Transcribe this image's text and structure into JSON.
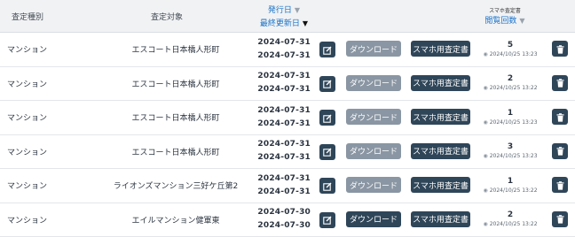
{
  "header": {
    "type": "査定種別",
    "target": "査定対象",
    "issue_date": "発行日",
    "updated_date": "最終更新日",
    "views_sub": "スマホ査定書",
    "views": "閲覧回数",
    "sort_neutral_icon": "▼",
    "sort_active_icon": "▼"
  },
  "colors": {
    "dark_button": "#2f4659",
    "disabled_button": "#8a96a3",
    "link_blue": "#1a73c9"
  },
  "rows": [
    {
      "type": "マンション",
      "target": "エスコート日本橋人形町",
      "issued": "2024-07-31",
      "updated": "2024-07-31",
      "download": "ダウンロード",
      "download_enabled": false,
      "smartphone": "スマホ用査定書",
      "views": "5",
      "viewed_at": "2024/10/25 13:23"
    },
    {
      "type": "マンション",
      "target": "エスコート日本橋人形町",
      "issued": "2024-07-31",
      "updated": "2024-07-31",
      "download": "ダウンロード",
      "download_enabled": false,
      "smartphone": "スマホ用査定書",
      "views": "2",
      "viewed_at": "2024/10/25 13:22"
    },
    {
      "type": "マンション",
      "target": "エスコート日本橋人形町",
      "issued": "2024-07-31",
      "updated": "2024-07-31",
      "download": "ダウンロード",
      "download_enabled": false,
      "smartphone": "スマホ用査定書",
      "views": "1",
      "viewed_at": "2024/10/25 13:23"
    },
    {
      "type": "マンション",
      "target": "エスコート日本橋人形町",
      "issued": "2024-07-31",
      "updated": "2024-07-31",
      "download": "ダウンロード",
      "download_enabled": false,
      "smartphone": "スマホ用査定書",
      "views": "3",
      "viewed_at": "2024/10/25 13:23"
    },
    {
      "type": "マンション",
      "target": "ライオンズマンション三好ケ丘第2",
      "issued": "2024-07-31",
      "updated": "2024-07-31",
      "download": "ダウンロード",
      "download_enabled": false,
      "smartphone": "スマホ用査定書",
      "views": "1",
      "viewed_at": "2024/10/25 13:22"
    },
    {
      "type": "マンション",
      "target": "エイルマンション健軍東",
      "issued": "2024-07-30",
      "updated": "2024-07-30",
      "download": "ダウンロード",
      "download_enabled": true,
      "smartphone": "スマホ用査定書",
      "views": "2",
      "viewed_at": "2024/10/25 13:22"
    }
  ]
}
